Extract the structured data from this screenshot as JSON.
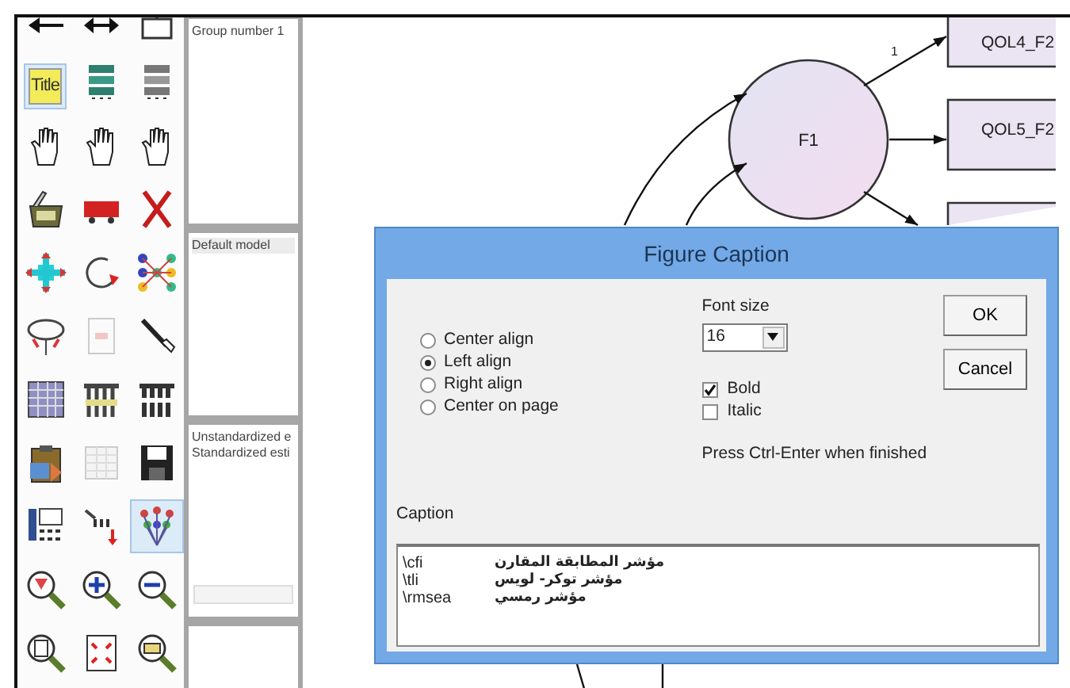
{
  "toolbar": [
    {
      "selected": false
    },
    {
      "selected": false
    },
    {
      "selected": false
    },
    {
      "label": "Title",
      "selected": true
    },
    {
      "selected": false
    },
    {
      "selected": false
    },
    {
      "selected": false
    },
    {
      "selected": false
    },
    {
      "selected": false
    },
    {
      "selected": false
    },
    {
      "selected": false
    },
    {
      "selected": false
    },
    {
      "selected": false
    },
    {
      "selected": false
    },
    {
      "selected": false
    },
    {
      "selected": false
    },
    {
      "selected": false
    },
    {
      "selected": false
    },
    {
      "selected": false
    },
    {
      "selected": false
    },
    {
      "selected": false
    },
    {
      "selected": false
    },
    {
      "selected": false
    },
    {
      "selected": false
    },
    {
      "selected": false
    },
    {
      "selected": false
    },
    {
      "selected": true
    },
    {
      "selected": false
    },
    {
      "selected": false
    },
    {
      "selected": false
    },
    {
      "selected": false
    },
    {
      "selected": false
    },
    {
      "selected": false
    }
  ],
  "panels": [
    {
      "kind": "list",
      "lines": [
        "Group number 1"
      ]
    },
    {
      "kind": "list",
      "lines": [
        "Default model"
      ]
    },
    {
      "kind": "scrolling",
      "lines": [
        "Unstandardized e",
        "Standardized esti"
      ]
    },
    {
      "kind": "list"
    }
  ],
  "diagram": {
    "nodes": [
      {
        "kind": "latent",
        "label": "F1"
      },
      {
        "kind": "observed",
        "label": "QOL4_F2"
      },
      {
        "kind": "observed",
        "label": "QOL5_F2"
      },
      {
        "kind": "observed"
      }
    ],
    "path_label": "1"
  },
  "dialog": {
    "title": "Figure Caption",
    "alignment": [
      {
        "label": "Center align",
        "selected": false
      },
      {
        "label": "Left align",
        "selected": true
      },
      {
        "label": "Right align",
        "selected": false
      },
      {
        "label": "Center on page",
        "selected": false
      }
    ],
    "font_size": {
      "label": "Font size",
      "value": "16"
    },
    "options": [
      {
        "label": "Bold",
        "checked": true
      },
      {
        "label": "Italic",
        "checked": false
      }
    ],
    "hint": "Press Ctrl-Enter when finished",
    "buttons": [
      "OK",
      "Cancel"
    ],
    "caption": {
      "label": "Caption",
      "lines": [
        {
          "code": "\\cfi",
          "text": "مؤشر المطابقة المقارن"
        },
        {
          "code": "\\tli",
          "text": "مؤشر توكر- لويس"
        },
        {
          "code": "\\rmsea",
          "text": "مؤشر رمسي"
        }
      ]
    }
  }
}
